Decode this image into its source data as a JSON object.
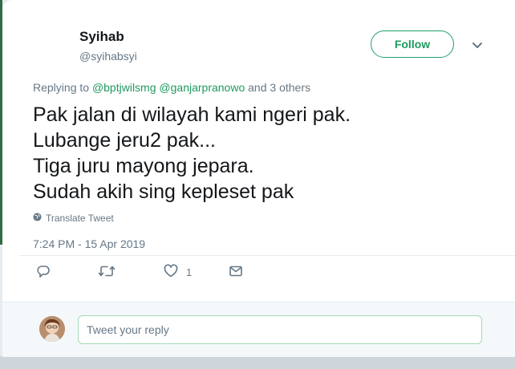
{
  "tweet": {
    "author_name": "Syihab",
    "author_handle": "@syihabsyi",
    "follow_label": "Follow",
    "replying_prefix": "Replying to",
    "mention_1": "@bptjwilsmg",
    "mention_2": "@ganjarpranowo",
    "replying_suffix": "and 3 others",
    "text_lines": [
      "Pak jalan di wilayah kami ngeri pak.",
      "Lubange jeru2 pak...",
      "Tiga juru mayong jepara.",
      "Sudah akih sing kepleset pak"
    ],
    "translate_label": "Translate Tweet",
    "timestamp": "7:24 PM - 15 Apr 2019",
    "like_count": "1"
  },
  "reply_box": {
    "placeholder": "Tweet your reply"
  },
  "icons": {
    "reply": "reply-icon",
    "retweet": "retweet-icon",
    "like": "heart-icon",
    "dm": "mail-icon",
    "globe": "globe-icon",
    "caret": "chevron-down-icon"
  },
  "colors": {
    "accent": "#1f9a5f",
    "muted": "#657786",
    "text": "#14171a"
  }
}
